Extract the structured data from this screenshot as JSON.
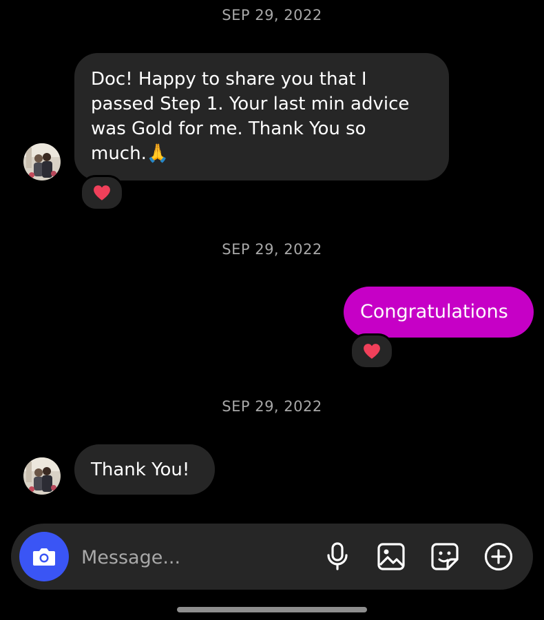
{
  "thread": {
    "groups": [
      {
        "date": "SEP 29, 2022",
        "message": {
          "direction": "incoming",
          "lines": [
            "Doc! Happy to share you that I",
            "passed Step 1. Your last min advice",
            "was Gold for me. Thank You so",
            "much.🙏"
          ],
          "reaction": "heart"
        }
      },
      {
        "date": "SEP 29, 2022",
        "message": {
          "direction": "outgoing",
          "text": "Congratulations",
          "reaction": "heart"
        }
      },
      {
        "date": "SEP 29, 2022",
        "message": {
          "direction": "incoming",
          "text": "Thank You!"
        }
      }
    ]
  },
  "composer": {
    "placeholder": "Message...",
    "icons": [
      "camera-icon",
      "microphone-icon",
      "gallery-icon",
      "sticker-icon",
      "add-icon"
    ]
  },
  "colors": {
    "background": "#000000",
    "incoming_bubble": "#262626",
    "outgoing_bubble": "#c600c6",
    "camera_button": "#3a55f5",
    "date_text": "#a8a8a8",
    "heart": "#f0405a"
  }
}
